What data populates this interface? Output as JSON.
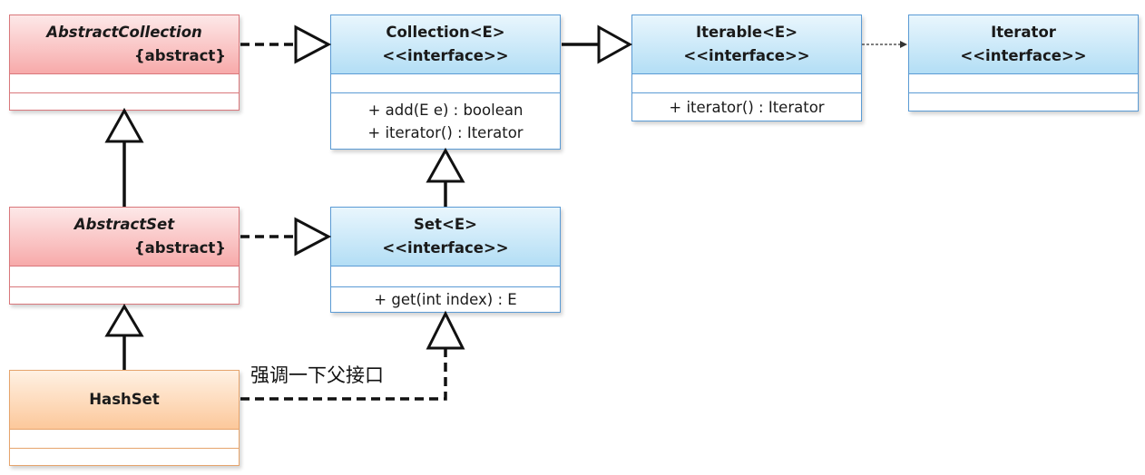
{
  "classes": {
    "abstract_collection": {
      "name": "AbstractCollection",
      "stereotype": "{abstract}"
    },
    "abstract_set": {
      "name": "AbstractSet",
      "stereotype": "{abstract}"
    },
    "hash_set": {
      "name": "HashSet"
    },
    "collection": {
      "name": "Collection<E>",
      "stereotype": "<<interface>>",
      "ops": [
        "+ add(E e) : boolean",
        "+ iterator() : Iterator"
      ]
    },
    "set": {
      "name": "Set<E>",
      "stereotype": "<<interface>>",
      "ops": [
        "+ get(int index) : E"
      ]
    },
    "iterable": {
      "name": "Iterable<E>",
      "stereotype": "<<interface>>",
      "ops": [
        "+ iterator() : Iterator"
      ]
    },
    "iterator": {
      "name": "Iterator",
      "stereotype": "<<interface>>"
    }
  },
  "annotation": "强调一下父接口",
  "colors": {
    "interface": "#b3def5",
    "abstract": "#f7aaaa",
    "concrete": "#fcc89b"
  }
}
